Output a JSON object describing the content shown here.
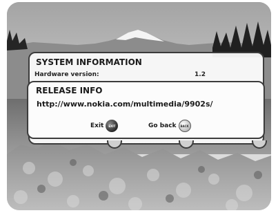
{
  "system_info": {
    "title": "SYSTEM INFORMATION",
    "hardware_label": "Hardware version:",
    "hardware_value": "1.2"
  },
  "release_info": {
    "title": "RELEASE INFO",
    "url": "http://www.nokia.com/multimedia/9902s/"
  },
  "buttons": {
    "exit_label": "Exit",
    "exit_key": "EXIT",
    "back_label": "Go back",
    "back_key": "BACK"
  },
  "colors": {
    "panel_bg": "#fcfcfc",
    "panel_border": "#3c3c3c",
    "text": "#1a1a1a"
  }
}
